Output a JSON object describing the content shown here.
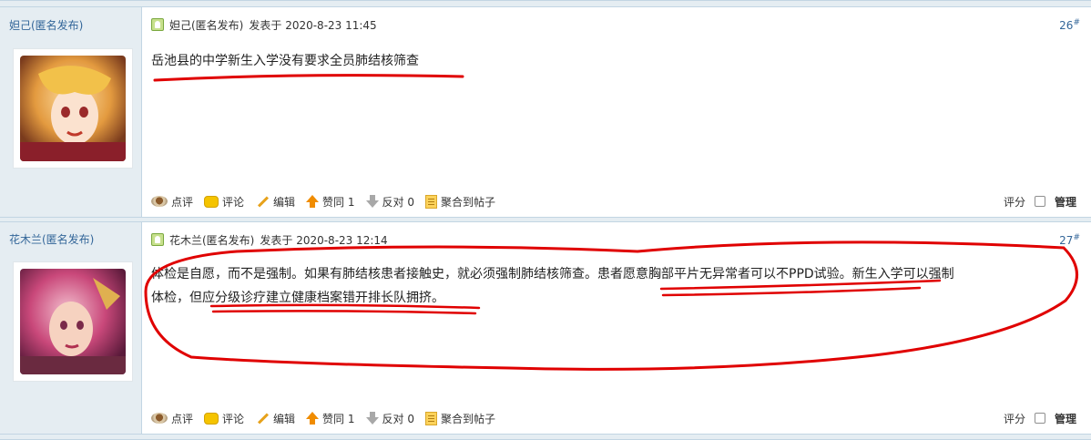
{
  "posts": [
    {
      "author": "妲己(匿名发布)",
      "meta_author": "妲己(匿名发布)",
      "posted": "发表于 2020-8-23 11:45",
      "floor": "26",
      "floor_mark": "#",
      "content": "岳池县的中学新生入学没有要求全员肺结核筛查",
      "actions": [
        "点评",
        "评论",
        "编辑",
        "赞同 1",
        "反对 0",
        "聚合到帖子"
      ],
      "rate": "评分",
      "manage": "管理"
    },
    {
      "author": "花木兰(匿名发布)",
      "meta_author": "花木兰(匿名发布)",
      "posted": "发表于 2020-8-23 12:14",
      "floor": "27",
      "floor_mark": "#",
      "content_line1": "体检是自愿，而不是强制。如果有肺结核患者接触史，就必须强制肺结核筛查。患者愿意胸部平片无异常者可以不PPD试验。新生入学可以强制",
      "content_line2": "体检，但应分级诊疗建立健康档案错开排长队拥挤。",
      "actions": [
        "点评",
        "评论",
        "编辑",
        "赞同 1",
        "反对 0",
        "聚合到帖子"
      ],
      "rate": "评分",
      "manage": "管理"
    }
  ],
  "colors": {
    "link": "#336699",
    "side_bg": "#e5edf2",
    "annotation": "#e00000"
  },
  "icons": [
    "online-icon",
    "review-icon",
    "comment-icon",
    "edit-icon",
    "thumb-up-icon",
    "thumb-down-icon",
    "collect-icon"
  ]
}
